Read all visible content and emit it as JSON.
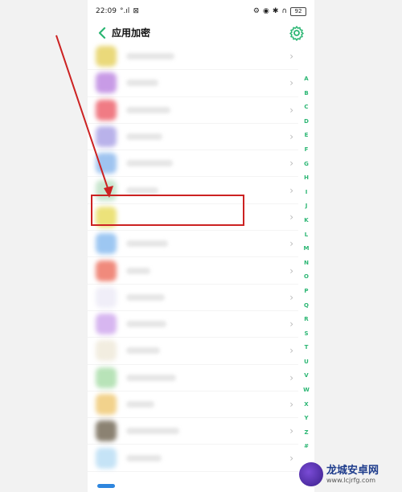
{
  "status_bar": {
    "time": "22:09",
    "signal_text": "°.ıl",
    "battery": "92"
  },
  "header": {
    "title": "应用加密"
  },
  "app_rows": [
    {
      "icon_color": "#ead97a",
      "name_width": 60
    },
    {
      "icon_color": "#c89be6",
      "name_width": 40
    },
    {
      "icon_color": "#f07b84",
      "name_width": 55
    },
    {
      "icon_color": "#b9b2ea",
      "name_width": 45
    },
    {
      "icon_color": "#9fc4f0",
      "name_width": 58
    },
    {
      "icon_color": "#c9e6cf",
      "name_width": 40
    },
    {
      "icon_color": "#ece27a",
      "name_width": 0
    },
    {
      "icon_color": "#9dc7f2",
      "name_width": 52
    },
    {
      "icon_color": "#f08a7c",
      "name_width": 30
    },
    {
      "icon_color": "#f0eef8",
      "name_width": 48
    },
    {
      "icon_color": "#d7b6f0",
      "name_width": 50
    },
    {
      "icon_color": "#f2ede0",
      "name_width": 42
    },
    {
      "icon_color": "#b8e3b8",
      "name_width": 62
    },
    {
      "icon_color": "#f2d28c",
      "name_width": 35
    },
    {
      "icon_color": "#8b8272",
      "name_width": 66
    },
    {
      "icon_color": "#c5e3f6",
      "name_width": 44
    }
  ],
  "index_letters": [
    "A",
    "B",
    "C",
    "D",
    "E",
    "F",
    "G",
    "H",
    "I",
    "J",
    "K",
    "L",
    "M",
    "N",
    "O",
    "P",
    "Q",
    "R",
    "S",
    "T",
    "U",
    "V",
    "W",
    "X",
    "Y",
    "Z",
    "#"
  ],
  "colors": {
    "accent": "#2bb673",
    "annotation": "#cc2222"
  },
  "watermark": {
    "title": "龙城安卓网",
    "url": "www.lcjrfg.com"
  }
}
